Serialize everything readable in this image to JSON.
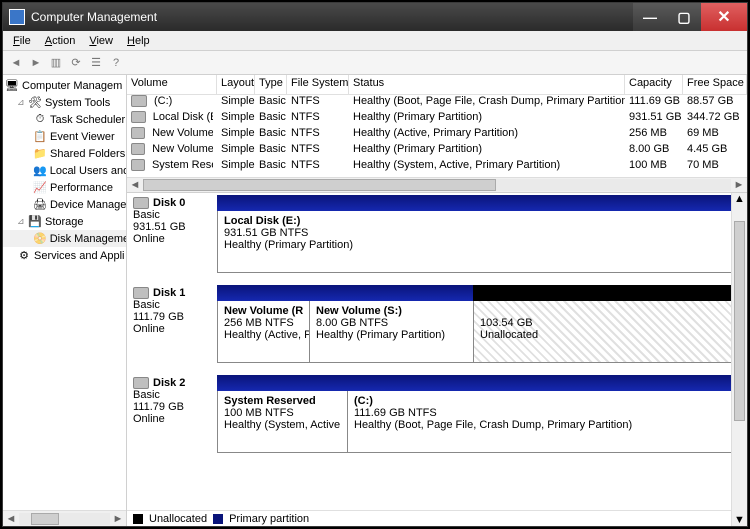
{
  "window": {
    "title": "Computer Management"
  },
  "menubar": {
    "file": "File",
    "action": "Action",
    "view": "View",
    "help": "Help"
  },
  "tree": {
    "root": "Computer Managem",
    "system_tools": "System Tools",
    "task_scheduler": "Task Scheduler",
    "event_viewer": "Event Viewer",
    "shared_folders": "Shared Folders",
    "local_users": "Local Users and",
    "performance": "Performance",
    "device_manager": "Device Manager",
    "storage": "Storage",
    "disk_mgmt": "Disk Manageme",
    "services": "Services and Appli"
  },
  "vol_headers": {
    "volume": "Volume",
    "layout": "Layout",
    "type": "Type",
    "fs": "File System",
    "status": "Status",
    "capacity": "Capacity",
    "free": "Free Space"
  },
  "volumes": [
    {
      "name": "(C:)",
      "layout": "Simple",
      "type": "Basic",
      "fs": "NTFS",
      "status": "Healthy (Boot, Page File, Crash Dump, Primary Partition)",
      "capacity": "111.69 GB",
      "free": "88.57 GB"
    },
    {
      "name": "Local Disk (E:)",
      "layout": "Simple",
      "type": "Basic",
      "fs": "NTFS",
      "status": "Healthy (Primary Partition)",
      "capacity": "931.51 GB",
      "free": "344.72 GB"
    },
    {
      "name": "New Volume (R:)",
      "layout": "Simple",
      "type": "Basic",
      "fs": "NTFS",
      "status": "Healthy (Active, Primary Partition)",
      "capacity": "256 MB",
      "free": "69 MB"
    },
    {
      "name": "New Volume (S:)",
      "layout": "Simple",
      "type": "Basic",
      "fs": "NTFS",
      "status": "Healthy (Primary Partition)",
      "capacity": "8.00 GB",
      "free": "4.45 GB"
    },
    {
      "name": "System Reserved",
      "layout": "Simple",
      "type": "Basic",
      "fs": "NTFS",
      "status": "Healthy (System, Active, Primary Partition)",
      "capacity": "100 MB",
      "free": "70 MB"
    }
  ],
  "disks": {
    "d0": {
      "title": "Disk 0",
      "type": "Basic",
      "size": "931.51 GB",
      "status": "Online",
      "p0": {
        "title": "Local Disk  (E:)",
        "sub": "931.51 GB NTFS",
        "stat": "Healthy (Primary Partition)"
      }
    },
    "d1": {
      "title": "Disk 1",
      "type": "Basic",
      "size": "111.79 GB",
      "status": "Online",
      "p0": {
        "title": "New Volume  (R",
        "sub": "256 MB NTFS",
        "stat": "Healthy (Active, P"
      },
      "p1": {
        "title": "New Volume  (S:)",
        "sub": "8.00 GB NTFS",
        "stat": "Healthy (Primary Partition)"
      },
      "p2": {
        "title": "",
        "sub": "103.54 GB",
        "stat": "Unallocated"
      }
    },
    "d2": {
      "title": "Disk 2",
      "type": "Basic",
      "size": "111.79 GB",
      "status": "Online",
      "p0": {
        "title": "System Reserved",
        "sub": "100 MB NTFS",
        "stat": "Healthy (System, Active"
      },
      "p1": {
        "title": "  (C:)",
        "sub": "111.69 GB NTFS",
        "stat": "Healthy (Boot, Page File, Crash Dump, Primary Partition)"
      }
    }
  },
  "legend": {
    "unallocated": "Unallocated",
    "primary": "Primary partition"
  }
}
